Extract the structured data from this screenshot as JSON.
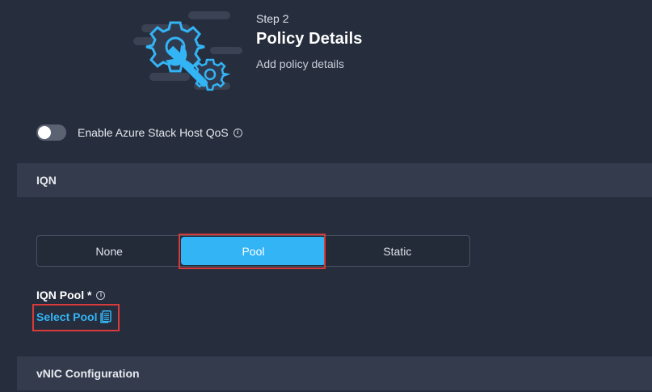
{
  "header": {
    "step_label": "Step 2",
    "title": "Policy Details",
    "subtitle": "Add policy details"
  },
  "qos": {
    "label": "Enable Azure Stack Host QoS",
    "enabled": false
  },
  "iqn_section": {
    "title": "IQN",
    "options": [
      "None",
      "Pool",
      "Static"
    ],
    "selected": "Pool"
  },
  "iqn_pool": {
    "label": "IQN Pool *",
    "link_text": "Select Pool"
  },
  "vnic_section": {
    "title": "vNIC Configuration"
  },
  "colors": {
    "background": "#262d3c",
    "section_bar": "#343b4c",
    "accent": "#33b4f5",
    "highlight": "#d93b3b"
  },
  "icons": {
    "hero": "gear-wrench-icon",
    "info": "info-icon",
    "pool_picker": "document-list-icon"
  }
}
